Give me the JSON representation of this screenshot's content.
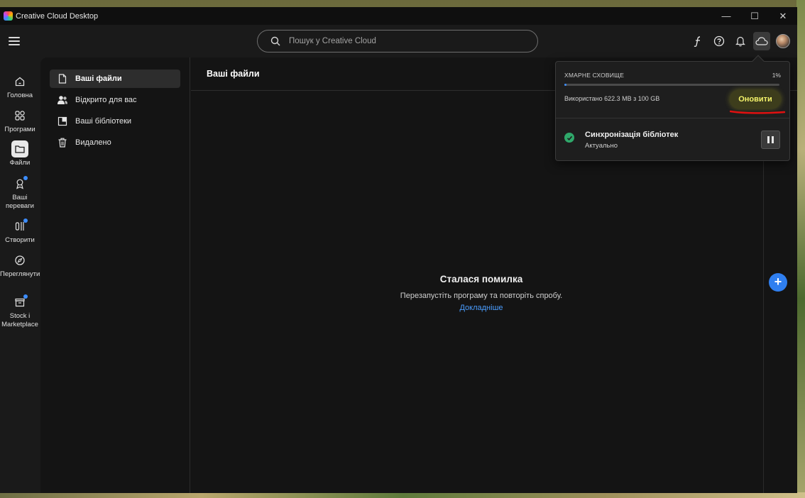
{
  "window": {
    "title": "Creative Cloud Desktop",
    "controls": [
      "—",
      "☐",
      "✕"
    ]
  },
  "search": {
    "placeholder": "Пошук у Creative Cloud"
  },
  "topbar_icons": [
    "fonts-icon",
    "help-icon",
    "bell-icon",
    "cloud-icon",
    "avatar"
  ],
  "leftnav": {
    "items": [
      {
        "label": "Головна",
        "icon": "home-icon",
        "active": false,
        "dot": false
      },
      {
        "label": "Програми",
        "icon": "apps-icon",
        "active": false,
        "dot": false
      },
      {
        "label": "Файли",
        "icon": "folder-icon",
        "active": true,
        "dot": false
      },
      {
        "label": "Ваші переваги",
        "icon": "badge-icon",
        "active": false,
        "dot": true
      },
      {
        "label": "Створити",
        "icon": "create-icon",
        "active": false,
        "dot": true
      },
      {
        "label": "Переглянути",
        "icon": "discover-icon",
        "active": false,
        "dot": false
      },
      {
        "label": "Stock і Marketplace",
        "icon": "stock-icon",
        "active": false,
        "dot": true
      }
    ]
  },
  "subnav": {
    "items": [
      {
        "label": "Ваші файли",
        "icon": "file-icon",
        "active": true
      },
      {
        "label": "Відкрито для вас",
        "icon": "people-icon",
        "active": false
      },
      {
        "label": "Ваші бібліотеки",
        "icon": "library-icon",
        "active": false
      },
      {
        "label": "Видалено",
        "icon": "trash-icon",
        "active": false
      }
    ]
  },
  "main": {
    "header": "Ваші файли",
    "error": {
      "title": "Сталася помилка",
      "message": "Перезапустіть програму та повторіть спробу.",
      "link": "Докладніше"
    }
  },
  "popover": {
    "storage_label": "ХМАРНЕ СХОВИЩЕ",
    "storage_percent": "1%",
    "storage_fraction": 0.01,
    "used_text": "Використано 622.3 MB з 100 GB",
    "upgrade_label": "Оновити",
    "sync_title": "Синхронізація бібліотек",
    "sync_status": "Актуально"
  },
  "colors": {
    "accent_blue": "#3c8dff",
    "success_green": "#2fa86a",
    "upgrade_text": "#f4f36a",
    "annotation_red": "#e01010"
  }
}
